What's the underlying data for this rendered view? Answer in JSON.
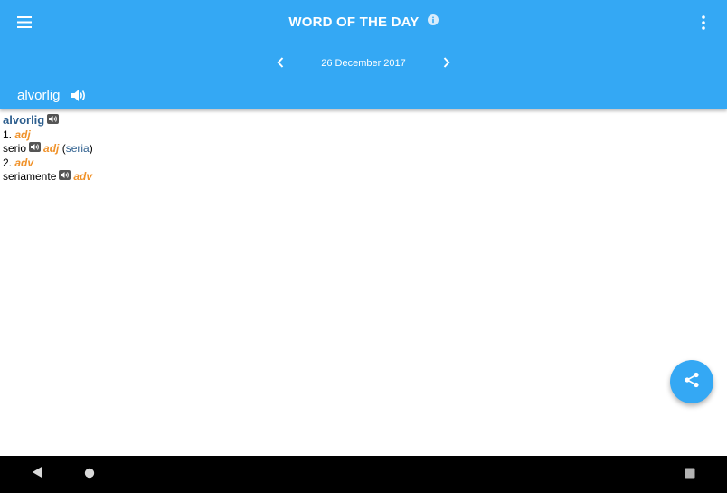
{
  "appbar": {
    "title": "WORD OF THE DAY",
    "date": "26 December 2017",
    "word": "alvorlig"
  },
  "entry": {
    "headword": "alvorlig",
    "senses": [
      {
        "number": "1.",
        "pos": "adj",
        "translation": "serio",
        "translation_pos": "adj",
        "open": "(",
        "feminine": "seria",
        "close": ")"
      },
      {
        "number": "2.",
        "pos": "adv",
        "translation": "seriamente",
        "translation_pos": "adv"
      }
    ]
  },
  "colors": {
    "primary": "#34a8f4",
    "headword": "#2e5f8e",
    "pos": "#f0922a",
    "navbar": "#000000"
  },
  "icons": [
    "menu-icon",
    "info-icon",
    "more-vert-icon",
    "chevron-left-icon",
    "chevron-right-icon",
    "speaker-icon",
    "share-icon",
    "back-triangle-icon",
    "home-circle-icon",
    "recents-square-icon"
  ]
}
